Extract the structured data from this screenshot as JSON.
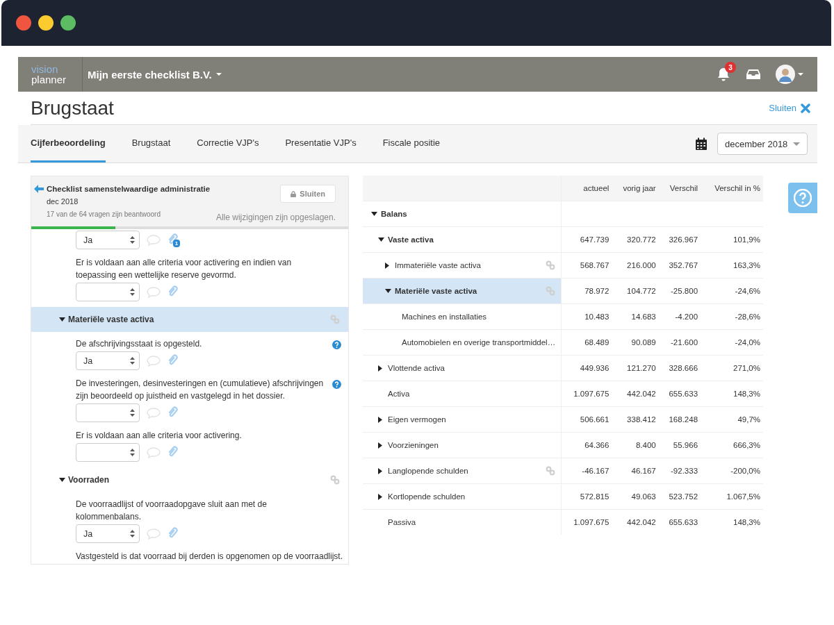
{
  "header": {
    "logo_top": "vision",
    "logo_bottom": "planner",
    "company": "Mijn eerste checklist B.V.",
    "notifications": "3"
  },
  "page": {
    "title": "Brugstaat",
    "close_label": "Sluiten"
  },
  "tabs": [
    {
      "label": "Cijferbeoordeling",
      "selected": true
    },
    {
      "label": "Brugstaat",
      "selected": false
    },
    {
      "label": "Correctie VJP's",
      "selected": false
    },
    {
      "label": "Presentatie VJP's",
      "selected": false
    },
    {
      "label": "Fiscale positie",
      "selected": false
    }
  ],
  "period": {
    "value": "december 2018"
  },
  "checklist": {
    "title": "Checklist samenstelwaardige administratie",
    "date": "dec 2018",
    "progress_text": "17 van de 64 vragen zijn beantwoord",
    "close_button": "Sluiten",
    "save_status": "Alle wijzigingen zijn opgeslagen.",
    "level": 0.266,
    "items": [
      {
        "kind": "question",
        "answer": "Ja",
        "help": false,
        "attachments": "1"
      },
      {
        "kind": "question",
        "text": "Er is voldaan aan alle criteria voor activering en indien van toepassing een wettelijke reserve gevormd.",
        "help": false
      },
      {
        "kind": "section",
        "title": "Materiële vaste activa",
        "expanded": true,
        "selected": true,
        "children": [
          {
            "kind": "question",
            "text": "De afschrijvingsstaat is opgesteld.",
            "answer": "Ja",
            "help": true
          },
          {
            "kind": "question",
            "text": "De investeringen, desinvesteringen en (cumulatieve) afschrijvingen zijn beoordeeld op juistheid en vastgelegd in het dossier.",
            "help": true
          },
          {
            "kind": "question",
            "text": "Er is voldaan aan alle criteria voor activering.",
            "help": false
          }
        ]
      },
      {
        "kind": "section",
        "title": "Voorraden",
        "expanded": true,
        "selected": false,
        "children": [
          {
            "kind": "question",
            "text": "De voorraadlijst of voorraadopgave sluit aan met de kolommenbalans.",
            "answer": "Ja",
            "help": false
          },
          {
            "kind": "note",
            "text": "Vastgesteld is dat voorraad bij derden is opgenomen op de voorraadlijst."
          }
        ]
      }
    ]
  },
  "table": {
    "columns": [
      "actueel",
      "vorig jaar",
      "Verschil",
      "Verschil in %"
    ],
    "rows": [
      {
        "label": "Balans",
        "expanded": true,
        "selected": false,
        "linked": false,
        "values": [],
        "children": [
          {
            "label": "Vaste activa",
            "expanded": true,
            "selected": false,
            "linked": false,
            "values": [
              "647.739",
              "320.772",
              "326.967",
              "101,9%"
            ],
            "children": [
              {
                "label": "Immateriële vaste activa",
                "expanded": false,
                "selected": false,
                "linked": true,
                "values": [
                  "568.767",
                  "216.000",
                  "352.767",
                  "163,3%"
                ]
              },
              {
                "label": "Materiële vaste activa",
                "expanded": true,
                "selected": true,
                "linked": true,
                "values": [
                  "78.972",
                  "104.772",
                  "-25.800",
                  "-24,6%"
                ],
                "children": [
                  {
                    "label": "Machines en installaties",
                    "selected": false,
                    "linked": false,
                    "values": [
                      "10.483",
                      "14.683",
                      "-4.200",
                      "-28,6%"
                    ]
                  },
                  {
                    "label": "Automobielen en overige transportmiddel…",
                    "selected": false,
                    "linked": false,
                    "values": [
                      "68.489",
                      "90.089",
                      "-21.600",
                      "-24,0%"
                    ]
                  }
                ]
              }
            ]
          },
          {
            "label": "Vlottende activa",
            "expanded": false,
            "selected": false,
            "linked": false,
            "values": [
              "449.936",
              "121.270",
              "328.666",
              "271,0%"
            ]
          },
          {
            "label": "Activa",
            "selected": false,
            "linked": false,
            "values": [
              "1.097.675",
              "442.042",
              "655.633",
              "148,3%"
            ]
          },
          {
            "label": "Eigen vermogen",
            "expanded": false,
            "selected": false,
            "linked": false,
            "values": [
              "506.661",
              "338.412",
              "168.248",
              "49,7%"
            ]
          },
          {
            "label": "Voorzieningen",
            "expanded": false,
            "selected": false,
            "linked": false,
            "values": [
              "64.366",
              "8.400",
              "55.966",
              "666,3%"
            ]
          },
          {
            "label": "Langlopende schulden",
            "expanded": false,
            "selected": false,
            "linked": true,
            "values": [
              "-46.167",
              "46.167",
              "-92.333",
              "-200,0%"
            ]
          },
          {
            "label": "Kortlopende schulden",
            "expanded": false,
            "selected": false,
            "linked": false,
            "values": [
              "572.815",
              "49.063",
              "523.752",
              "1.067,5%"
            ]
          },
          {
            "label": "Passiva",
            "selected": false,
            "linked": false,
            "values": [
              "1.097.675",
              "442.042",
              "655.633",
              "148,3%"
            ]
          }
        ]
      }
    ]
  }
}
